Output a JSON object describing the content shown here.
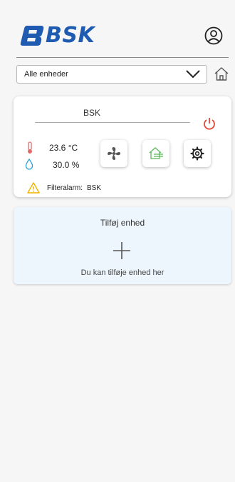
{
  "brand": {
    "name": "BSK",
    "color": "#1e5bb1",
    "icon": "bsk-logo-icon"
  },
  "header": {
    "account_icon": "account-icon"
  },
  "device_select": {
    "value": "Alle enheder",
    "icon": "chevron-down-icon"
  },
  "home_icon": "home-icon",
  "device_card": {
    "name": "BSK",
    "power_icon": "power-icon",
    "power_color": "#e04a3b",
    "temperature": "23.6 °C",
    "humidity": "30.0 %",
    "buttons": [
      "fan-icon",
      "house-ventilation-icon",
      "gear-icon"
    ],
    "alarm_label": "Filteralarm:",
    "alarm_device": "BSK",
    "warning_color": "#f0b400"
  },
  "add_device": {
    "title": "Tilføj enhed",
    "subtitle": "Du kan tilføje enhed her",
    "background": "#eef6fd"
  }
}
